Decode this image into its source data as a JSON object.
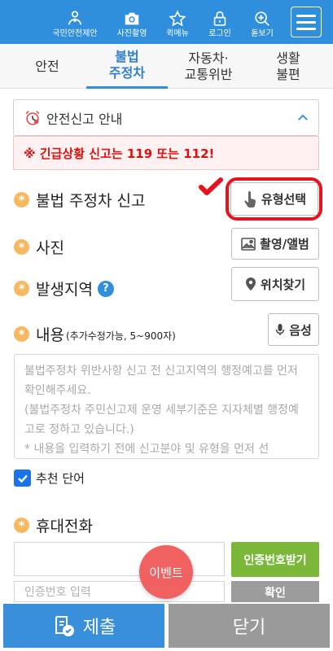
{
  "header": {
    "nav": [
      {
        "label": "국민안전제안",
        "icon": "person-heart-icon"
      },
      {
        "label": "사진촬영",
        "icon": "camera-icon"
      },
      {
        "label": "퀵메뉴",
        "icon": "star-icon"
      },
      {
        "label": "로그인",
        "icon": "lock-icon"
      },
      {
        "label": "돋보기",
        "icon": "zoom-plus-icon"
      }
    ],
    "menu_icon": "hamburger-icon"
  },
  "tabs": [
    {
      "label_1": "안전",
      "label_2": ""
    },
    {
      "label_1": "불법",
      "label_2": "주정차"
    },
    {
      "label_1": "자동차·",
      "label_2": "교통위반"
    },
    {
      "label_1": "생활",
      "label_2": "불편"
    }
  ],
  "notice": {
    "title": "안전신고 안내",
    "emergency": "※ 긴급상황 신고는 119 또는 112!"
  },
  "form": {
    "report_type": {
      "label": "불법 주정차 신고",
      "button": "유형선택"
    },
    "photo": {
      "label": "사진",
      "button": "촬영/앨범"
    },
    "location": {
      "label": "발생지역",
      "help": "?",
      "button": "위치찾기"
    },
    "content": {
      "label": "내용",
      "hint": "(추가수정가능, 5~900자)",
      "button": "음성",
      "placeholder": "불법주정차 위반사항 신고 전 신고지역의 행정예고를 먼저 확인해주세요.\n(불법주정차 주민신고제 운영 세부기준은 지자체별 행정예고로 정하고 있습니다.)\n* 내용을 입력하기 전에 신고분야 및 유형을 먼저 선"
    },
    "recommend": {
      "label": "추천 단어",
      "checked": true
    },
    "phone": {
      "label": "휴대전화",
      "auth_button": "인증번호받기",
      "auth_placeholder": "인증번호 입력",
      "confirm_button": "확인"
    }
  },
  "event_button": "이벤트",
  "bottom": {
    "submit": "제출",
    "close": "닫기"
  },
  "colors": {
    "primary": "#2f8fdc",
    "accent_orange": "#f7b860",
    "alert_red": "#e01010",
    "green": "#7bb83a"
  }
}
